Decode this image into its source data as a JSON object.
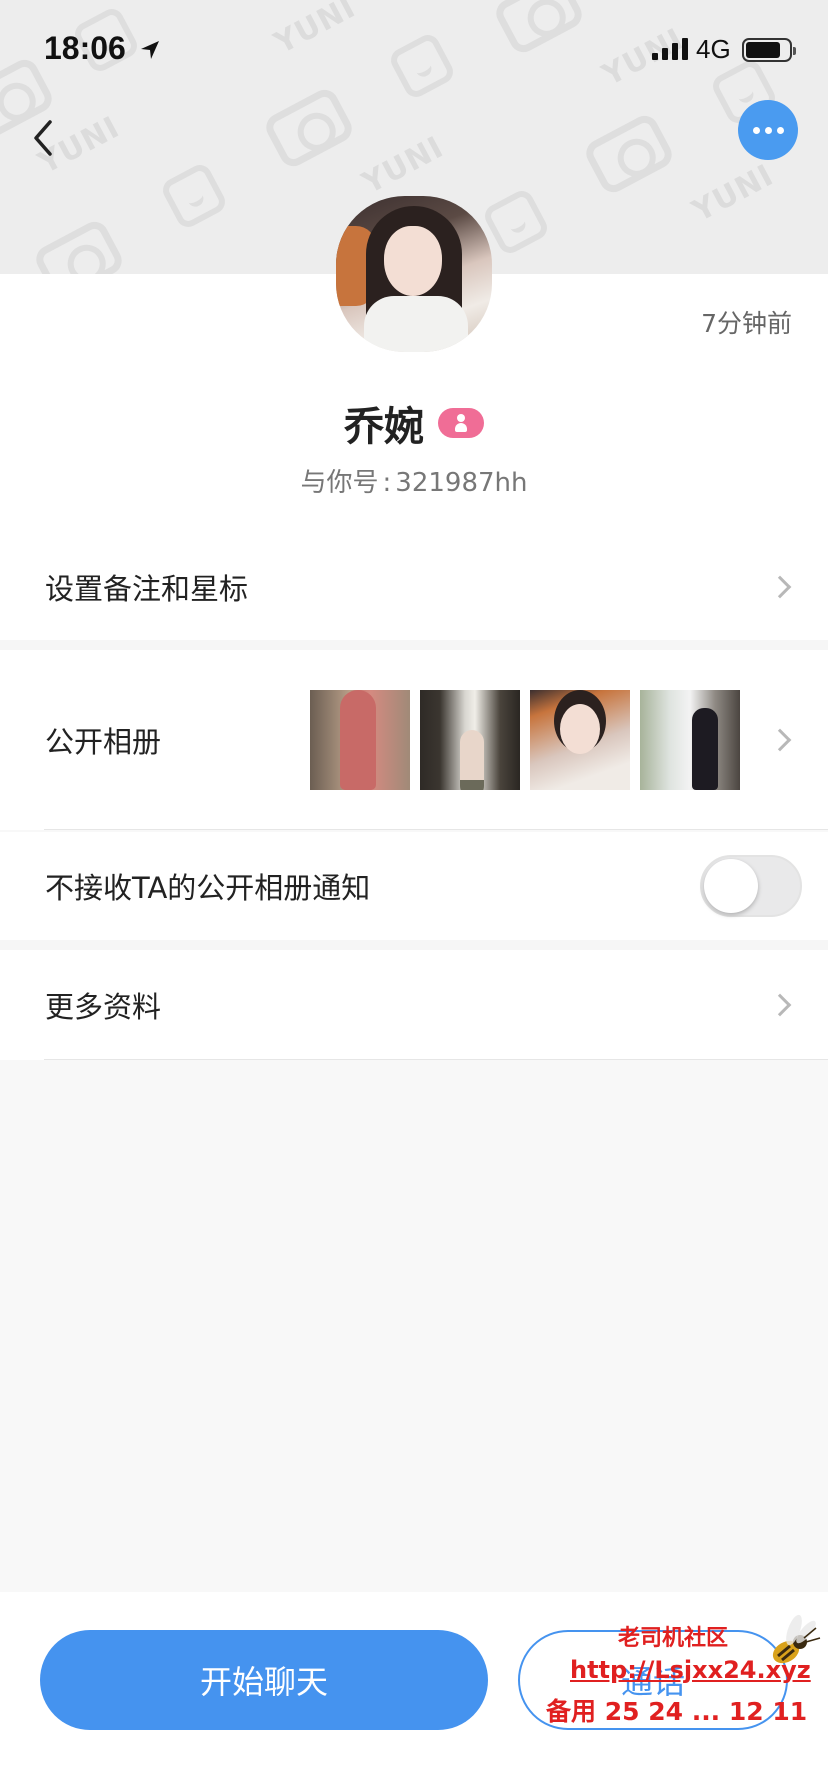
{
  "status_bar": {
    "time": "18:06",
    "network": "4G",
    "battery_level": 0.8
  },
  "header": {
    "background_watermark": "YUNI",
    "more_icon": "more-dots-icon",
    "back_icon": "back-chevron-icon"
  },
  "profile": {
    "name": "乔婉",
    "last_seen": "7分钟前",
    "id_label": "与你号",
    "id_separator": ":",
    "id_value": "321987hh",
    "gender": "female"
  },
  "rows": {
    "remark_label": "设置备注和星标",
    "album_label": "公开相册",
    "album_mute_label": "不接收TA的公开相册通知",
    "album_mute_on": false,
    "more_info_label": "更多资料"
  },
  "bottom": {
    "chat_label": "开始聊天",
    "call_label": "通话"
  },
  "overlay_watermark": {
    "line1": "老司机社区",
    "line2": "http://Lsjxx24.xyz",
    "line3": "备用 25 24 ... 12 11"
  },
  "colors": {
    "accent": "#4593ef",
    "badge_pink": "#f06d96",
    "watermark_red": "#e02020"
  }
}
